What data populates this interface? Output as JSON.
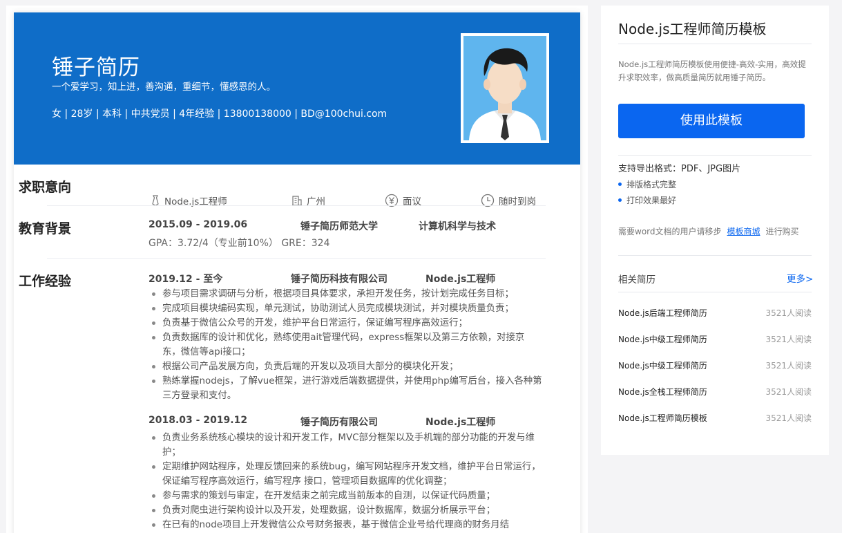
{
  "resume": {
    "name": "锤子简历",
    "motto": "一个爱学习，知上进，善沟通，重细节，懂感恩的人。",
    "info": "女 | 28岁 | 本科 | 中共党员 | 4年经验 | 13800138000 | BD@100chui.com",
    "sections": {
      "intent": "求职意向",
      "education": "教育背景",
      "work": "工作经验"
    },
    "intent": {
      "position": "Node.js工程师",
      "city": "广州",
      "salary": "面议",
      "availability": "随时到岗"
    },
    "education": {
      "period": "2015.09 - 2019.06",
      "school": "锤子简历师范大学",
      "major": "计算机科学与技术",
      "scores": "GPA：3.72/4（专业前10%） GRE：324"
    },
    "jobs": [
      {
        "period": "2019.12 - 至今",
        "company": "锤子简历科技有限公司",
        "title": "Node.js工程师",
        "duties": [
          "参与项目需求调研与分析，根据项目具体要求，承担开发任务，按计划完成任务目标；",
          "完成项目模块编码实现，单元测试，协助测试人员完成模块测试，并对模块质量负责；",
          "负责基于微信公众号的开发，维护平台日常运行，保证编写程序高效运行；",
          "负责数据库的设计和优化，熟练使用ait管理代码，express框架以及第三方依赖，对接京东，微信等api接口；",
          "根据公司产品发展方向，负责后端的开发以及项目大部分的模块化开发；",
          "熟练掌握nodejs，了解vue框架，进行游戏后端数据提供，并使用php编写后台，接入各种第三方登录和支付。"
        ]
      },
      {
        "period": "2018.03 - 2019.12",
        "company": "锤子简历有限公司",
        "title": "Node.js工程师",
        "duties": [
          "负责业务系统核心模块的设计和开发工作，MVC部分框架以及手机端的部分功能的开发与维护；",
          "定期维护网站程序，处理反馈回来的系统bug，编写网站程序开发文档，维护平台日常运行，保证编写程序高效运行，编写程序 接口，管理项目数据库的优化调整；",
          "参与需求的策划与审定，在开发结束之前完成当前版本的自测，以保证代码质量；",
          "负责对爬虫进行架构设计以及开发，处理数据，设计数据库，数据分析展示平台；",
          "在已有的node项目上开发微信公众号财务报表，基于微信企业号给代理商的财务月结"
        ]
      }
    ]
  },
  "sidebar": {
    "title": "Node.js工程师简历模板",
    "description": "Node.js工程师简历模板使用便捷-高效-实用，高效提升求职效率，做高质量简历就用锤子简历。",
    "use_button": "使用此模板",
    "formats": "支持导出格式：PDF、JPG图片",
    "features": [
      "排版格式完整",
      "打印效果最好"
    ],
    "word_note_prefix": "需要word文档的用户请移步",
    "word_note_link": "模板商城",
    "word_note_suffix": "进行购买",
    "related_heading": "相关简历",
    "more": "更多>",
    "related": [
      {
        "name": "Node.js后端工程师简历",
        "reads": "3521人阅读"
      },
      {
        "name": "Node.js中级工程师简历",
        "reads": "3521人阅读"
      },
      {
        "name": "Node.js中级工程师简历",
        "reads": "3521人阅读"
      },
      {
        "name": "Node.js全栈工程师简历",
        "reads": "3521人阅读"
      },
      {
        "name": "Node.js工程师简历模板",
        "reads": "3521人阅读"
      }
    ]
  },
  "colors": {
    "hero_blue": "#0f6dc8",
    "accent_blue": "#0a66f0",
    "photo_bg": "#5fb5ee"
  }
}
